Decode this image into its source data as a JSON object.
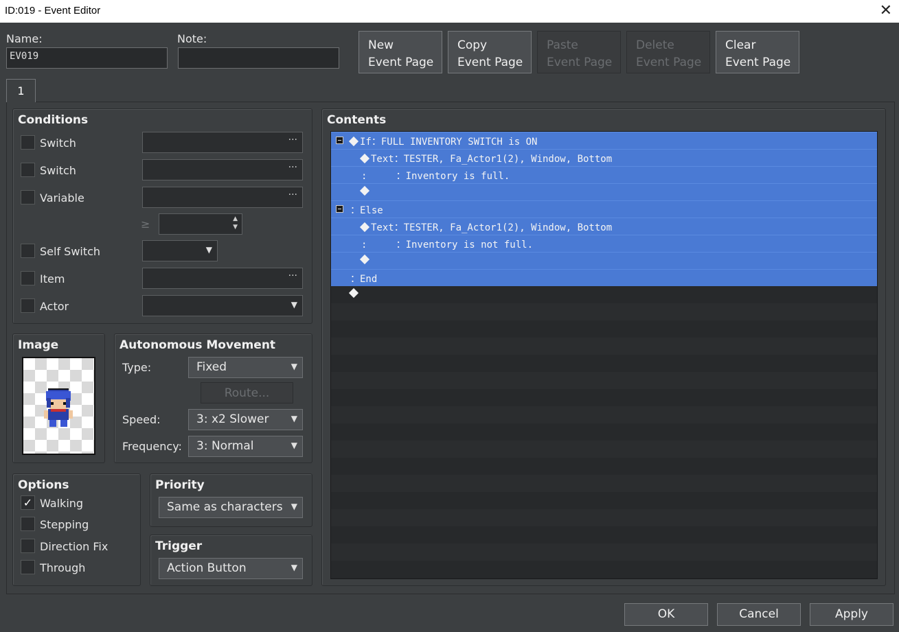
{
  "window": {
    "title": "ID:019 - Event Editor",
    "close_glyph": "✕"
  },
  "name": {
    "label": "Name:",
    "value": "EV019"
  },
  "note": {
    "label": "Note:",
    "value": ""
  },
  "page_buttons": [
    {
      "line1": "New",
      "line2": "Event Page",
      "enabled": true
    },
    {
      "line1": "Copy",
      "line2": "Event Page",
      "enabled": true
    },
    {
      "line1": "Paste",
      "line2": "Event Page",
      "enabled": false
    },
    {
      "line1": "Delete",
      "line2": "Event Page",
      "enabled": false
    },
    {
      "line1": "Clear",
      "line2": "Event Page",
      "enabled": true
    }
  ],
  "tabs": [
    {
      "label": "1",
      "selected": true
    }
  ],
  "conditions": {
    "title": "Conditions",
    "switch1_label": "Switch",
    "switch2_label": "Switch",
    "variable_label": "Variable",
    "ge_symbol": "≥",
    "self_switch_label": "Self Switch",
    "item_label": "Item",
    "actor_label": "Actor",
    "dots": "···"
  },
  "image": {
    "title": "Image",
    "sprite": "blue-haired-character-sprite"
  },
  "autonomous": {
    "title": "Autonomous Movement",
    "type_label": "Type:",
    "type_value": "Fixed",
    "route_label": "Route...",
    "speed_label": "Speed:",
    "speed_value": "3: x2 Slower",
    "frequency_label": "Frequency:",
    "frequency_value": "3: Normal"
  },
  "options": {
    "title": "Options",
    "items": [
      {
        "label": "Walking",
        "checked": true
      },
      {
        "label": "Stepping",
        "checked": false
      },
      {
        "label": "Direction Fix",
        "checked": false
      },
      {
        "label": "Through",
        "checked": false
      }
    ]
  },
  "priority": {
    "title": "Priority",
    "value": "Same as characters"
  },
  "trigger": {
    "title": "Trigger",
    "value": "Action Button"
  },
  "contents": {
    "title": "Contents",
    "lines": [
      {
        "text": "If：FULL INVENTORY SWITCH is ON",
        "diamond": true,
        "fold": true,
        "indent": 0
      },
      {
        "text": "Text：TESTER, Fa_Actor1(2), Window, Bottom",
        "diamond": true,
        "fold": false,
        "indent": 1
      },
      {
        "text": ":     ：Inventory is full.",
        "diamond": false,
        "fold": false,
        "indent": 1
      },
      {
        "text": "",
        "diamond": true,
        "fold": false,
        "indent": 1
      },
      {
        "text": "：Else",
        "diamond": false,
        "fold": true,
        "indent": 0
      },
      {
        "text": "Text：TESTER, Fa_Actor1(2), Window, Bottom",
        "diamond": true,
        "fold": false,
        "indent": 1
      },
      {
        "text": ":     ：Inventory is not full.",
        "diamond": false,
        "fold": false,
        "indent": 1
      },
      {
        "text": "",
        "diamond": true,
        "fold": false,
        "indent": 1
      },
      {
        "text": "：End",
        "diamond": false,
        "fold": false,
        "indent": 0
      },
      {
        "text": "",
        "diamond": true,
        "fold": false,
        "indent": 0
      }
    ],
    "selected_count": 9
  },
  "footer": {
    "ok": "OK",
    "cancel": "Cancel",
    "apply": "Apply"
  },
  "colors": {
    "selection": "#4a7ad4",
    "background": "#3c3f41"
  }
}
